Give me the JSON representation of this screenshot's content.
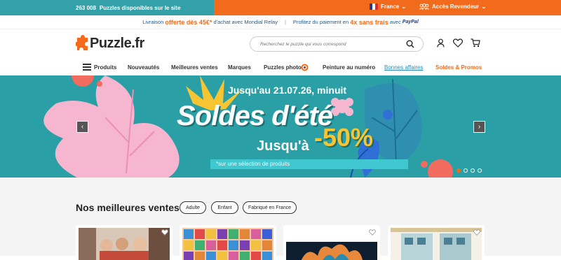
{
  "topbar": {
    "count": "263 008",
    "count_text": "Puzzles disponibles sur le site",
    "language": "France",
    "reseller": "Accès Revendeur"
  },
  "delivery": {
    "part1": "Livraison",
    "offer": "offerte dès 45€*",
    "part2": "d'achat avec Mondial Relay",
    "sep": "|",
    "pay1": "Profitez du paiement en",
    "pay_offer": "4x sans frais",
    "pay2": "avec",
    "paypal": "PayPal"
  },
  "header": {
    "logo_text": "Puzzle.fr",
    "search_placeholder": "Recherchez le puzzle qui vous correspond",
    "icons": [
      "user-icon",
      "heart-icon",
      "cart-icon"
    ]
  },
  "nav": {
    "items": [
      {
        "label": "Produits"
      },
      {
        "label": "Nouveautés"
      },
      {
        "label": "Meilleures ventes"
      },
      {
        "label": "Marques"
      },
      {
        "label": "Puzzles photo"
      },
      {
        "label": "Peinture au numéro"
      },
      {
        "label": "Bonnes affaires"
      },
      {
        "label": "Soldes & Promos"
      }
    ]
  },
  "banner": {
    "date": "Jusqu'au 21.07.26, minuit",
    "headline": "Soldes d'été",
    "upto": "Jusqu'à",
    "discount": "-50%",
    "note": "*sur une sélection de produits",
    "slides": 4,
    "active_slide": 1
  },
  "bestsellers": {
    "title": "Nos meilleures ventes",
    "filters": [
      "Adulte",
      "Enfant",
      "Fabriqué en France"
    ]
  },
  "colors": {
    "teal": "#34a0a8",
    "orange": "#f26b1d",
    "banner_bg": "#2aa0a6",
    "pink": "#f7b6d0",
    "yellow": "#f7c531"
  }
}
